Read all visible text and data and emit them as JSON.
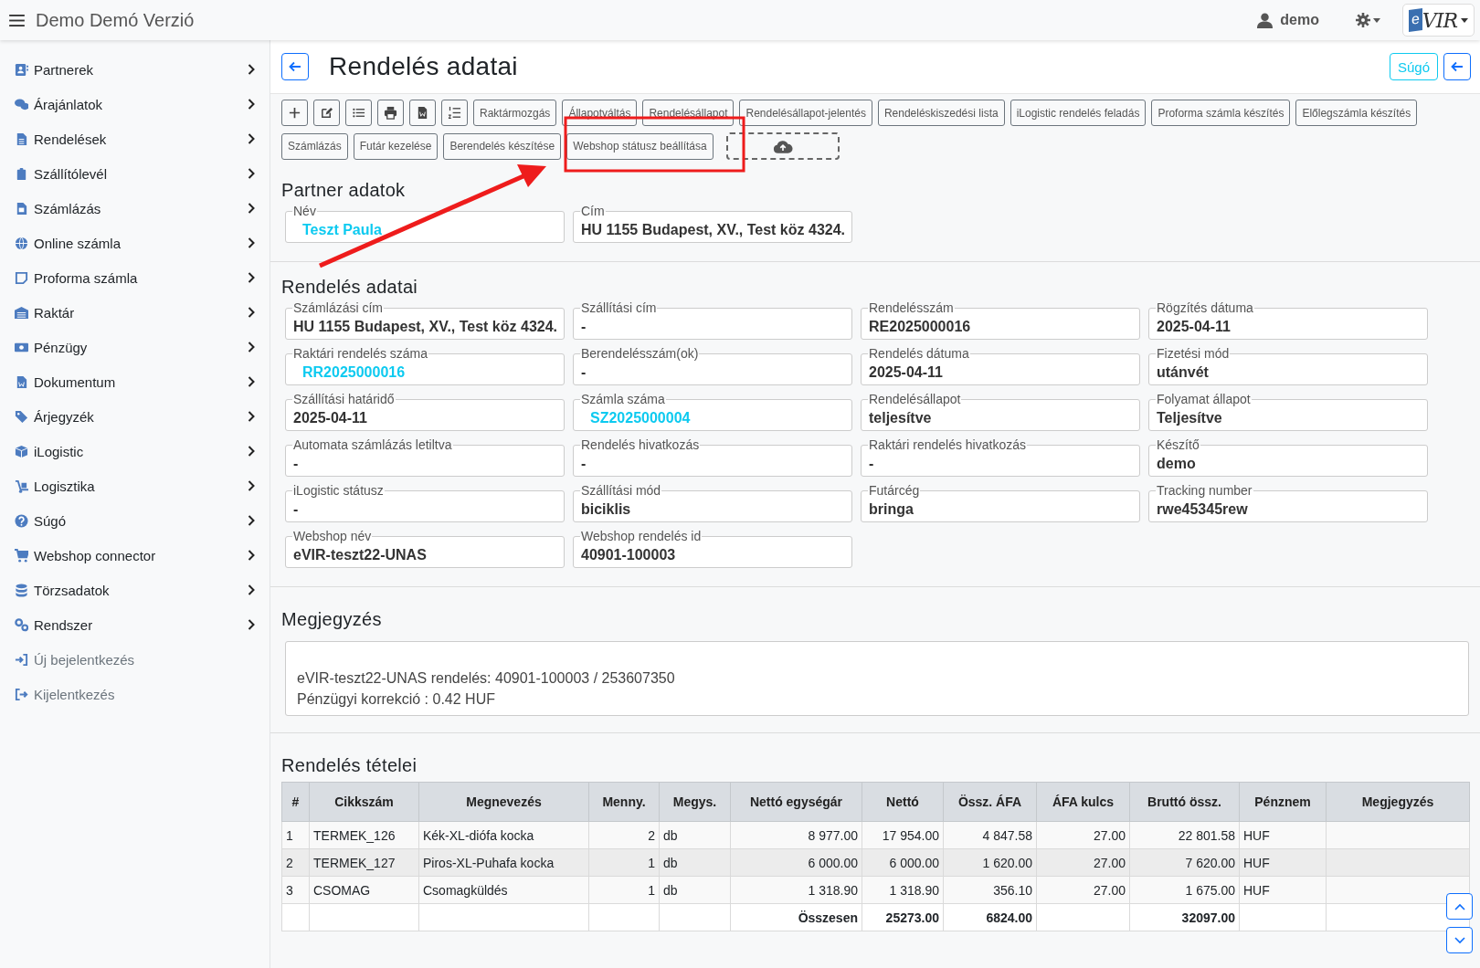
{
  "header": {
    "title": "Demo Demó Verzió",
    "user": "demo",
    "logo": {
      "mark": "e",
      "text": "VIR"
    }
  },
  "page": {
    "title": "Rendelés adatai",
    "help_button": "Súgó"
  },
  "toolbar": {
    "primary_buttons": [
      "Raktármozgás",
      "Állapotváltás",
      "Rendelésállapot",
      "Rendelésállapot-jelentés",
      "Rendeléskiszedési lista",
      "iLogistic rendelés feladás",
      "Proforma számla készítés",
      "Előlegszámla készítés"
    ],
    "secondary_buttons": [
      "Számlázás",
      "Futár kezelése",
      "Berendelés készítése",
      "Webshop státusz beállítása"
    ]
  },
  "sidebar": {
    "items": [
      {
        "label": "Partnerek",
        "kind": "menu"
      },
      {
        "label": "Árajánlatok",
        "kind": "menu"
      },
      {
        "label": "Rendelések",
        "kind": "menu"
      },
      {
        "label": "Szállítólevél",
        "kind": "menu"
      },
      {
        "label": "Számlázás",
        "kind": "menu"
      },
      {
        "label": "Online számla",
        "kind": "menu"
      },
      {
        "label": "Proforma számla",
        "kind": "menu"
      },
      {
        "label": "Raktár",
        "kind": "menu"
      },
      {
        "label": "Pénzügy",
        "kind": "menu"
      },
      {
        "label": "Dokumentum",
        "kind": "menu"
      },
      {
        "label": "Árjegyzék",
        "kind": "menu"
      },
      {
        "label": "iLogistic",
        "kind": "menu"
      },
      {
        "label": "Logisztika",
        "kind": "menu"
      },
      {
        "label": "Súgó",
        "kind": "menu"
      },
      {
        "label": "Webshop connector",
        "kind": "menu"
      },
      {
        "label": "Törzsadatok",
        "kind": "menu"
      },
      {
        "label": "Rendszer",
        "kind": "menu"
      },
      {
        "label": "Új bejelentkezés",
        "kind": "action"
      },
      {
        "label": "Kijelentkezés",
        "kind": "action"
      }
    ]
  },
  "partner": {
    "title": "Partner adatok",
    "fields": [
      {
        "label": "Név",
        "value": "Teszt Paula",
        "link": true
      },
      {
        "label": "Cím",
        "value": "HU 1155 Budapest, XV., Test köz 4324.",
        "link": false
      }
    ]
  },
  "order": {
    "title": "Rendelés adatai",
    "fields": [
      {
        "label": "Számlázási cím",
        "value": "HU 1155 Budapest, XV., Test köz 4324.",
        "link": false
      },
      {
        "label": "Szállítási cím",
        "value": "-",
        "link": false
      },
      {
        "label": "Rendelésszám",
        "value": "RE2025000016",
        "link": false
      },
      {
        "label": "Rögzítés dátuma",
        "value": "2025-04-11",
        "link": false
      },
      {
        "label": "Raktári rendelés száma",
        "value": "RR2025000016",
        "link": true
      },
      {
        "label": "Berendelésszám(ok)",
        "value": "-",
        "link": false
      },
      {
        "label": "Rendelés dátuma",
        "value": "2025-04-11",
        "link": false
      },
      {
        "label": "Fizetési mód",
        "value": "utánvét",
        "link": false
      },
      {
        "label": "Szállítási határidő",
        "value": "2025-04-11",
        "link": false
      },
      {
        "label": "Számla száma",
        "value": "SZ2025000004",
        "link": true
      },
      {
        "label": "Rendelésállapot",
        "value": "teljesítve",
        "link": false
      },
      {
        "label": "Folyamat állapot",
        "value": "Teljesítve",
        "link": false
      },
      {
        "label": "Automata számlázás letiltva",
        "value": "-",
        "link": false
      },
      {
        "label": "Rendelés hivatkozás",
        "value": "-",
        "link": false
      },
      {
        "label": "Raktári rendelés hivatkozás",
        "value": "-",
        "link": false
      },
      {
        "label": "Készítő",
        "value": "demo",
        "link": false
      },
      {
        "label": "iLogistic státusz",
        "value": "-",
        "link": false
      },
      {
        "label": "Szállítási mód",
        "value": "biciklis",
        "link": false
      },
      {
        "label": "Futárcég",
        "value": "bringa",
        "link": false
      },
      {
        "label": "Tracking number",
        "value": "rwe45345rew",
        "link": false
      },
      {
        "label": "Webshop név",
        "value": "eVIR-teszt22-UNAS",
        "link": false
      },
      {
        "label": "Webshop rendelés id",
        "value": "40901-100003",
        "link": false
      }
    ]
  },
  "note": {
    "title": "Megjegyzés",
    "lines": [
      "eVIR-teszt22-UNAS rendelés: 40901-100003 / 253607350",
      "Pénzügyi korrekció : 0.42 HUF"
    ]
  },
  "items": {
    "title": "Rendelés tételei",
    "columns": [
      "#",
      "Cikkszám",
      "Megnevezés",
      "Menny.",
      "Megys.",
      "Nettó egységár",
      "Nettó",
      "Össz. ÁFA",
      "ÁFA kulcs",
      "Bruttó össz.",
      "Pénznem",
      "Megjegyzés"
    ],
    "rows": [
      [
        "1",
        "TERMEK_126",
        "Kék-XL-diófa kocka",
        "2",
        "db",
        "8 977.00",
        "17 954.00",
        "4 847.58",
        "27.00",
        "22 801.58",
        "HUF",
        ""
      ],
      [
        "2",
        "TERMEK_127",
        "Piros-XL-Puhafa kocka",
        "1",
        "db",
        "6 000.00",
        "6 000.00",
        "1 620.00",
        "27.00",
        "7 620.00",
        "HUF",
        ""
      ],
      [
        "3",
        "CSOMAG",
        "Csomagküldés",
        "1",
        "db",
        "1 318.90",
        "1 318.90",
        "356.10",
        "27.00",
        "1 675.00",
        "HUF",
        ""
      ]
    ],
    "total": {
      "label": "Összesen",
      "net": "25273.00",
      "vat": "6824.00",
      "gross": "32097.00"
    }
  }
}
